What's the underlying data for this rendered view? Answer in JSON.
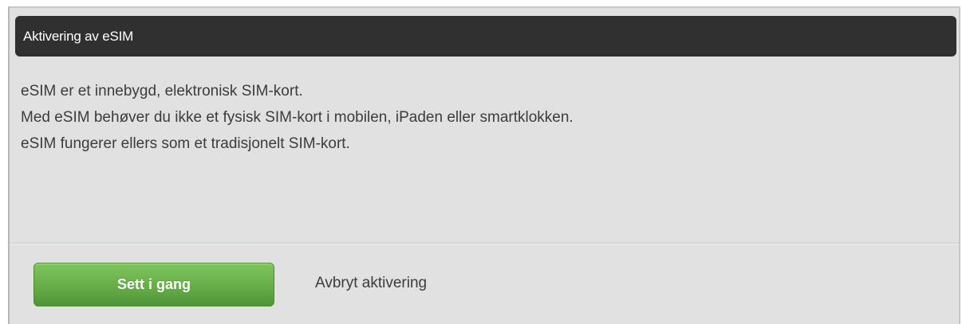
{
  "dialog": {
    "title": "Aktivering av eSIM",
    "body_lines": [
      "eSIM er et innebygd, elektronisk SIM-kort.",
      "Med eSIM behøver du ikke et fysisk SIM-kort i mobilen, iPaden eller smartklokken.",
      "eSIM fungerer ellers som et tradisjonelt SIM-kort."
    ],
    "primary_button_label": "Sett i gang",
    "cancel_link_label": "Avbryt aktivering"
  },
  "colors": {
    "title_bar": "#303030",
    "dialog_background": "#e1e1e1",
    "primary_button": "#67ae49",
    "text": "#3c3c3c"
  }
}
